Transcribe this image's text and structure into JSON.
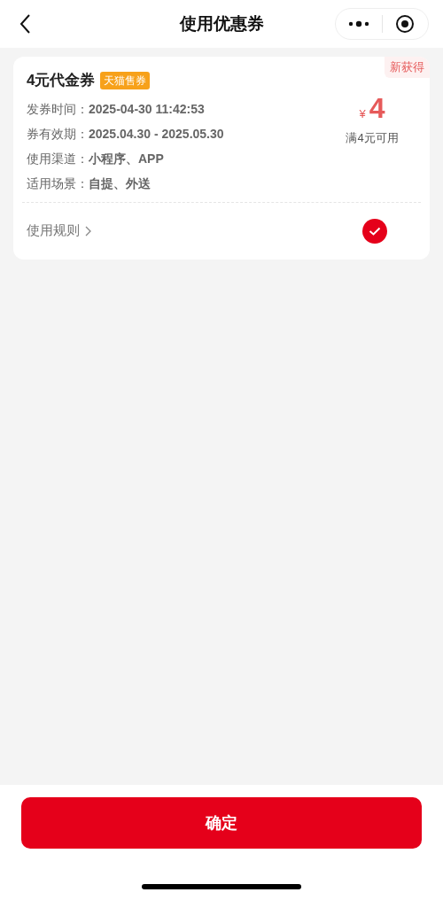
{
  "header": {
    "title": "使用优惠券"
  },
  "coupon": {
    "title": "4元代金券",
    "tag": "天猫售券",
    "badge": "新获得",
    "currency": "¥",
    "amount": "4",
    "condition": "满4元可用",
    "selected": true,
    "details": [
      {
        "label": "发券时间：",
        "value": "2025-04-30 11:42:53"
      },
      {
        "label": "券有效期：",
        "value": "2025.04.30 - 2025.05.30"
      },
      {
        "label": "使用渠道：",
        "value": "小程序、APP"
      },
      {
        "label": "适用场景：",
        "value": "自提、外送"
      }
    ],
    "rules_link": "使用规则"
  },
  "confirm_button": "确定"
}
